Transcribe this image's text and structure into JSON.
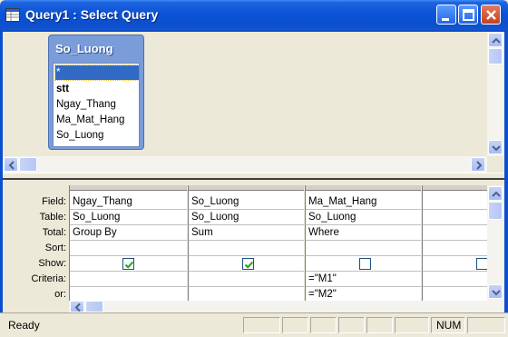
{
  "window": {
    "title": "Query1 : Select Query"
  },
  "table_box": {
    "title": "So_Luong",
    "fields": [
      "*",
      "stt",
      "Ngay_Thang",
      "Ma_Mat_Hang",
      "So_Luong"
    ],
    "selected_field": "*",
    "bold_field": "stt"
  },
  "grid": {
    "row_labels": [
      "Field:",
      "Table:",
      "Total:",
      "Sort:",
      "Show:",
      "Criteria:",
      "or:"
    ],
    "columns": [
      {
        "field": "Ngay_Thang",
        "table": "So_Luong",
        "total": "Group By",
        "sort": "",
        "show": true,
        "criteria": "",
        "or": ""
      },
      {
        "field": "So_Luong",
        "table": "So_Luong",
        "total": "Sum",
        "sort": "",
        "show": true,
        "criteria": "",
        "or": ""
      },
      {
        "field": "Ma_Mat_Hang",
        "table": "So_Luong",
        "total": "Where",
        "sort": "",
        "show": false,
        "criteria": "=\"M1\"",
        "or": "=\"M2\""
      },
      {
        "field": "",
        "table": "",
        "total": "",
        "sort": "",
        "show": false,
        "criteria": "",
        "or": ""
      }
    ]
  },
  "statusbar": {
    "status": "Ready",
    "num_indicator": "NUM"
  },
  "colors": {
    "titlebar": "#0b4fcf",
    "selection": "#316ac5",
    "checkbox_check": "#21a121"
  }
}
